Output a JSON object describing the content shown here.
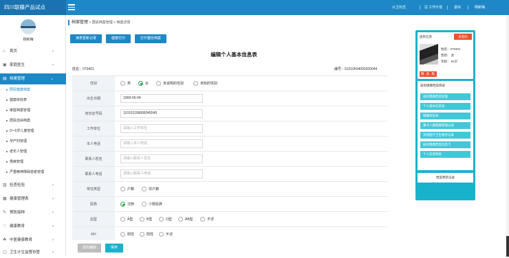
{
  "app": {
    "title": "四川联藤产品试点"
  },
  "topnav": {
    "cloud": "公卫日志",
    "plan": "工作计划",
    "logout": "退出",
    "user": "杨新梅"
  },
  "user": {
    "name": "杨新梅"
  },
  "sidebar": {
    "items": [
      {
        "label": "首页"
      },
      {
        "label": "家庭医生"
      },
      {
        "label": "档案管理"
      }
    ],
    "sub": [
      {
        "label": "居民健康档案"
      },
      {
        "label": "健康体检表"
      },
      {
        "label": "家庭档案管理"
      },
      {
        "label": "居民自由档案"
      },
      {
        "label": "0～6岁儿童管理"
      },
      {
        "label": "孕产妇管理"
      },
      {
        "label": "老年人管理"
      },
      {
        "label": "慢病管理"
      },
      {
        "label": "严重精神障碍患者管理"
      }
    ],
    "bottom": [
      {
        "label": "检查检验"
      },
      {
        "label": "健康管理表"
      },
      {
        "label": "预防接种"
      },
      {
        "label": "健康教育"
      },
      {
        "label": "中医健康教育"
      },
      {
        "label": "卫生计生监督协管"
      }
    ]
  },
  "breadcrumb": {
    "root": "档案管理",
    "sep1": ">",
    "l1": "居民档案管理",
    "sep2": ">",
    "l2": "档案详情"
  },
  "actions": {
    "update": "读表更新记录",
    "print_health": "健康打印",
    "print_cover": "打印整份档案"
  },
  "form": {
    "title": "编辑个人基本信息表",
    "name_label": "姓名：",
    "name": "070401",
    "id_label": "编号：",
    "id": "51010604000200044"
  },
  "fields": {
    "gender": {
      "label": "性别",
      "options": [
        "男",
        "女",
        "未说明的性别",
        "未知的性别"
      ],
      "selected": "女"
    },
    "birth": {
      "label": "出生日期",
      "value": "1968-06-04"
    },
    "idcard": {
      "label": "身份证号码",
      "value": "110101196806045545"
    },
    "work": {
      "label": "工作单位",
      "placeholder": "请输入工作单位"
    },
    "phone": {
      "label": "本人电话",
      "placeholder": "请输入本人电话"
    },
    "contact": {
      "label": "联系人姓名",
      "placeholder": "请输入联系人姓名"
    },
    "contact_phone": {
      "label": "联系人电话",
      "placeholder": "请输入联系人电话"
    },
    "residence": {
      "label": "常住类型",
      "options": [
        "户籍",
        "非户籍"
      ]
    },
    "ethnic": {
      "label": "民族",
      "options": [
        "汉族",
        "少数民族"
      ],
      "selected": "汉族"
    },
    "blood": {
      "label": "血型",
      "options": [
        "A型",
        "B型",
        "O型",
        "AB型",
        "不详"
      ]
    },
    "rh": {
      "label": "RH",
      "options": [
        "阴性",
        "阳性",
        "不详"
      ]
    }
  },
  "footer": {
    "cancel": "退出编辑",
    "save": "保存"
  },
  "panel": {
    "title": "居民信息",
    "sign": "未签约",
    "name": "姓名：070401",
    "gender": "性别： 女",
    "age": "年龄： 51岁",
    "tags": "糖 高 脂",
    "dir_title": "居民健康档案目录",
    "dir": [
      "居民健康档案封面",
      "个人基本信息表",
      "健康体检表",
      "重点人群健康管理记录",
      "其他医疗卫生服务记录",
      "居民健康档案信息卡",
      "个人信息附款"
    ],
    "bottom": "档案更新记录"
  }
}
